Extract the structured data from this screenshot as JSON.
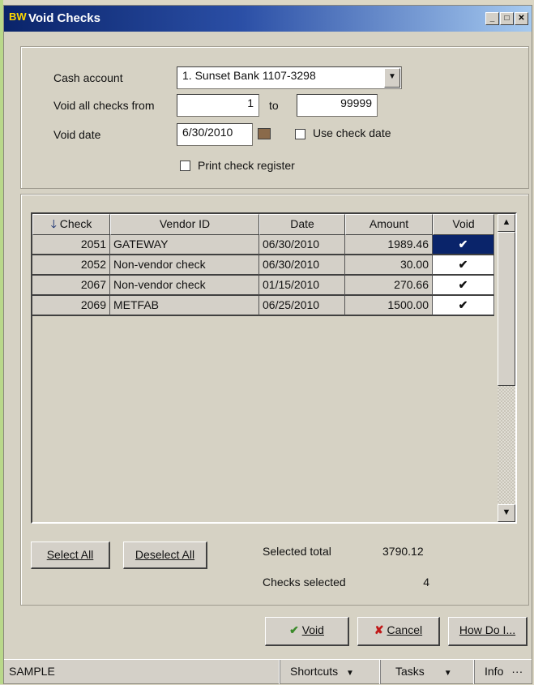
{
  "window": {
    "title": "Void Checks",
    "app_icon": "BW"
  },
  "form": {
    "cash_account_label": "Cash account",
    "cash_account_value": "1. Sunset Bank 1107-3298",
    "void_from_label": "Void all checks from",
    "void_from_value": "1",
    "to_label": "to",
    "void_to_value": "99999",
    "void_date_label": "Void date",
    "void_date_value": "6/30/2010",
    "use_check_date_label": "Use check date",
    "print_register_label": "Print check register"
  },
  "table": {
    "columns": [
      "Check",
      "Vendor ID",
      "Date",
      "Amount",
      "Void"
    ],
    "rows": [
      {
        "check": "2051",
        "vendor": "GATEWAY",
        "date": "06/30/2010",
        "amount": "1989.46",
        "void": "✔"
      },
      {
        "check": "2052",
        "vendor": "Non-vendor check",
        "date": "06/30/2010",
        "amount": "30.00",
        "void": "✔"
      },
      {
        "check": "2067",
        "vendor": "Non-vendor check",
        "date": "01/15/2010",
        "amount": "270.66",
        "void": "✔"
      },
      {
        "check": "2069",
        "vendor": "METFAB",
        "date": "06/25/2010",
        "amount": "1500.00",
        "void": "✔"
      }
    ]
  },
  "summary": {
    "select_all": "Select All",
    "deselect_all": "Deselect All",
    "selected_total_label": "Selected total",
    "selected_total_value": "3790.12",
    "checks_selected_label": "Checks selected",
    "checks_selected_value": "4"
  },
  "actions": {
    "void": "Void",
    "cancel": "Cancel",
    "help": "How Do I..."
  },
  "statusbar": {
    "mode": "SAMPLE",
    "shortcuts": "Shortcuts",
    "tasks": "Tasks",
    "info": "Info"
  }
}
